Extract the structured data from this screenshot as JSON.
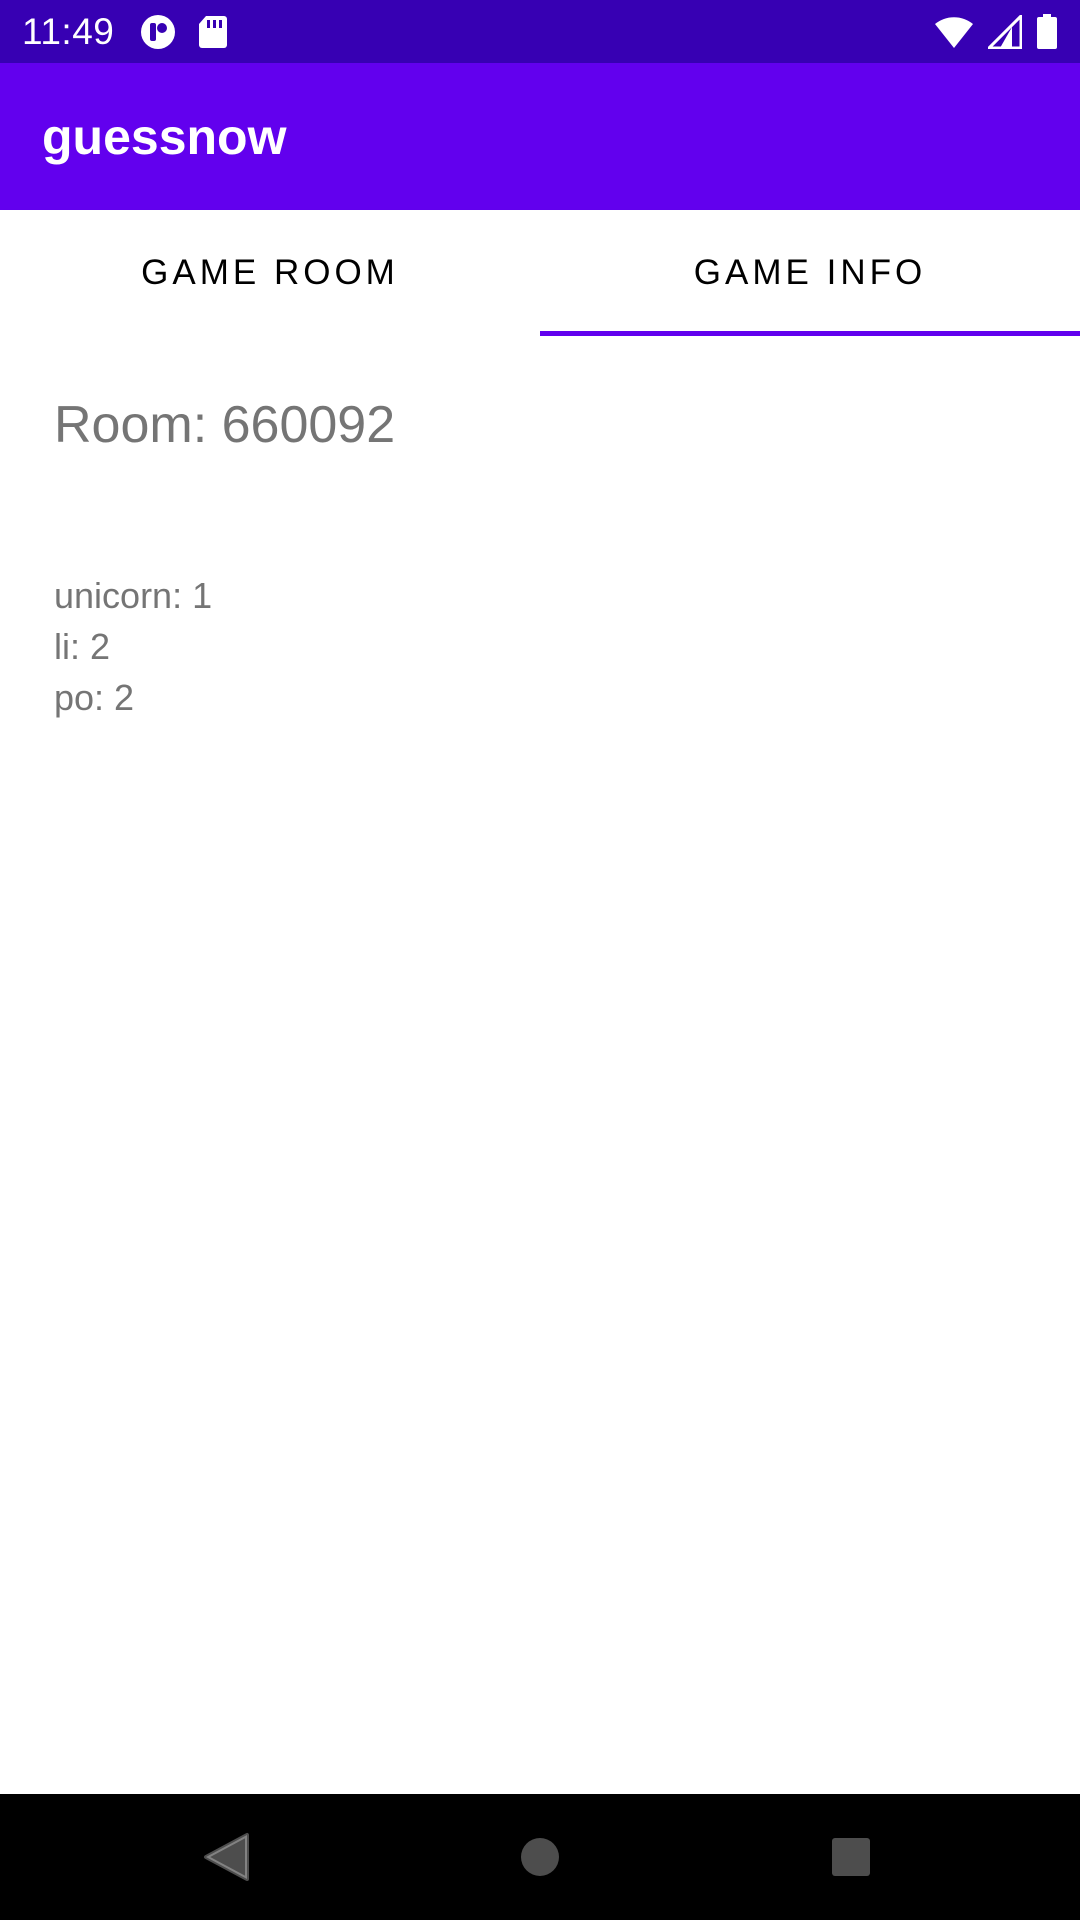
{
  "status_bar": {
    "time": "11:49",
    "left_icons": [
      "notification-app-icon",
      "sd-card-icon"
    ],
    "right_icons": [
      "wifi-icon",
      "cell-signal-icon",
      "battery-icon"
    ],
    "background": "#3700b3"
  },
  "app_bar": {
    "title": "guessnow",
    "background": "#6200ee"
  },
  "tabs": [
    {
      "label": "GAME ROOM",
      "selected": false
    },
    {
      "label": "GAME INFO",
      "selected": true
    }
  ],
  "accent_color": "#6200ee",
  "game_info": {
    "room_label": "Room: 660092",
    "scores": [
      {
        "text": "unicorn: 1"
      },
      {
        "text": "li: 2"
      },
      {
        "text": "po: 2"
      }
    ]
  },
  "nav_bar": {
    "buttons": [
      "back-icon",
      "home-icon",
      "recents-icon"
    ]
  }
}
